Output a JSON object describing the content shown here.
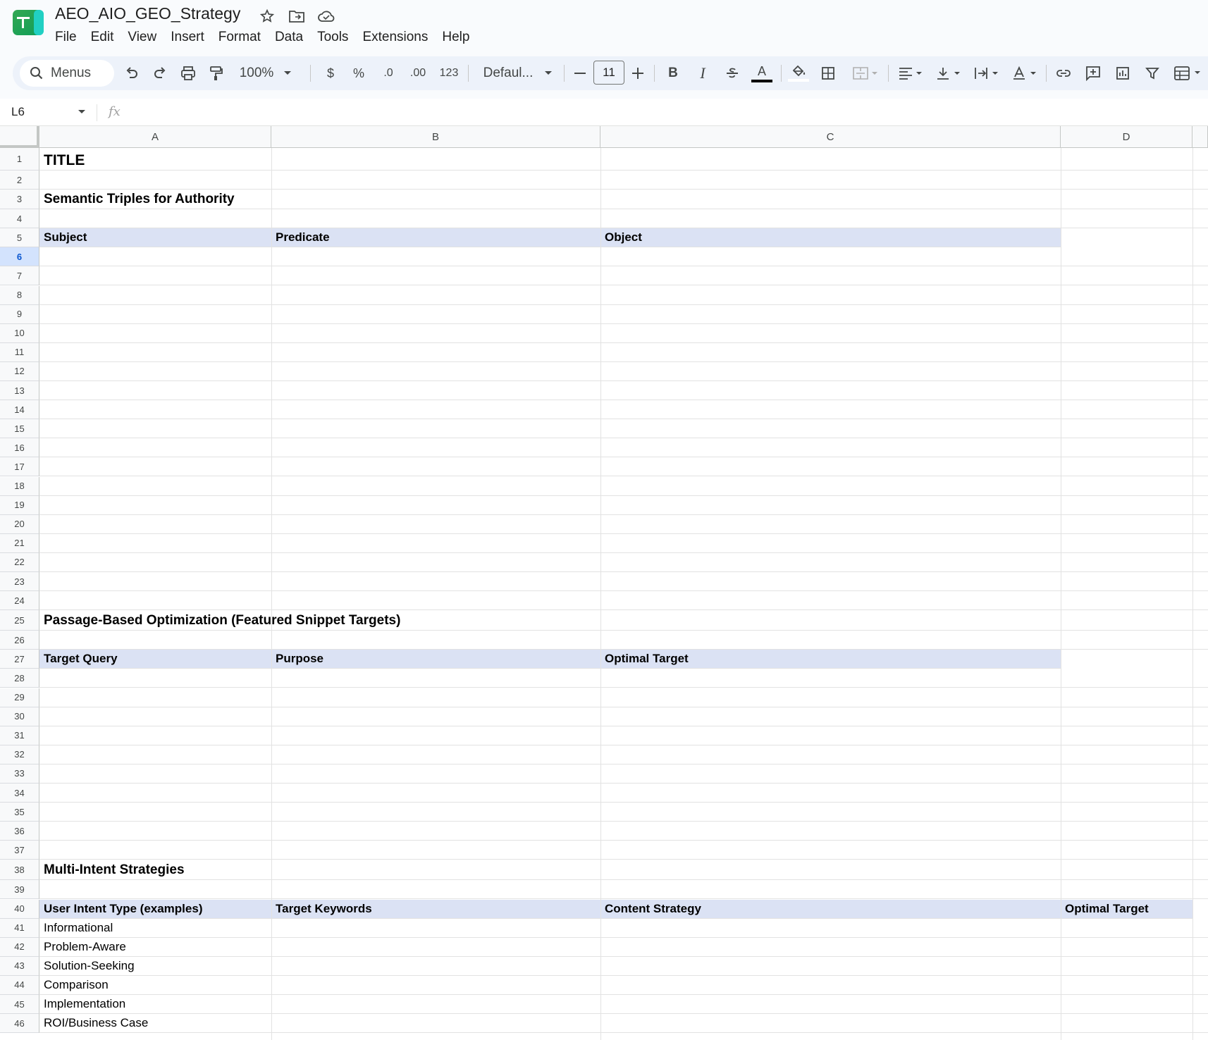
{
  "document": {
    "title": "AEO_AIO_GEO_Strategy"
  },
  "menu": [
    "File",
    "Edit",
    "View",
    "Insert",
    "Format",
    "Data",
    "Tools",
    "Extensions",
    "Help"
  ],
  "toolbar": {
    "search_label": "Menus",
    "zoom": "100%",
    "currency": "$",
    "percent": "%",
    "decrease_decimal": ".0",
    "increase_decimal": ".00",
    "number_format": "123",
    "font": "Defaul...",
    "font_size": "11",
    "bold": "B",
    "italic": "I",
    "text_color_glyph": "A"
  },
  "formula_bar": {
    "cell_ref": "L6",
    "fx": "fx",
    "value": ""
  },
  "columns": [
    "A",
    "B",
    "C",
    "D"
  ],
  "selected_row": 6,
  "rows": [
    {
      "n": "1",
      "cells": [
        {
          "col": "A",
          "text": "TITLE",
          "style": "title"
        }
      ]
    },
    {
      "n": "2",
      "cells": []
    },
    {
      "n": "3",
      "cells": [
        {
          "col": "A",
          "text": "Semantic Triples for Authority",
          "style": "section"
        }
      ]
    },
    {
      "n": "4",
      "cells": []
    },
    {
      "n": "5",
      "header": true,
      "cells": [
        {
          "col": "A",
          "text": "Subject",
          "style": "b"
        },
        {
          "col": "B",
          "text": "Predicate",
          "style": "b"
        },
        {
          "col": "C",
          "text": "Object",
          "style": "b"
        }
      ]
    },
    {
      "n": "6",
      "cells": []
    },
    {
      "n": "7",
      "cells": []
    },
    {
      "n": "8",
      "cells": []
    },
    {
      "n": "9",
      "cells": []
    },
    {
      "n": "10",
      "cells": []
    },
    {
      "n": "11",
      "cells": []
    },
    {
      "n": "12",
      "cells": []
    },
    {
      "n": "13",
      "cells": []
    },
    {
      "n": "14",
      "cells": []
    },
    {
      "n": "15",
      "cells": []
    },
    {
      "n": "16",
      "cells": []
    },
    {
      "n": "17",
      "cells": []
    },
    {
      "n": "18",
      "cells": []
    },
    {
      "n": "19",
      "cells": []
    },
    {
      "n": "20",
      "cells": []
    },
    {
      "n": "21",
      "cells": []
    },
    {
      "n": "22",
      "cells": []
    },
    {
      "n": "23",
      "cells": []
    },
    {
      "n": "24",
      "cells": []
    },
    {
      "n": "25",
      "cells": [
        {
          "col": "A",
          "text": "Passage-Based Optimization (Featured Snippet Targets)",
          "style": "section"
        }
      ]
    },
    {
      "n": "26",
      "cells": []
    },
    {
      "n": "27",
      "header": true,
      "cells": [
        {
          "col": "A",
          "text": "Target Query",
          "style": "b"
        },
        {
          "col": "B",
          "text": "Purpose",
          "style": "b"
        },
        {
          "col": "C",
          "text": "Optimal Target",
          "style": "b"
        }
      ]
    },
    {
      "n": "28",
      "cells": []
    },
    {
      "n": "29",
      "cells": []
    },
    {
      "n": "30",
      "cells": []
    },
    {
      "n": "31",
      "cells": []
    },
    {
      "n": "32",
      "cells": []
    },
    {
      "n": "33",
      "cells": []
    },
    {
      "n": "34",
      "cells": []
    },
    {
      "n": "35",
      "cells": []
    },
    {
      "n": "36",
      "cells": []
    },
    {
      "n": "37",
      "cells": []
    },
    {
      "n": "38",
      "cells": [
        {
          "col": "A",
          "text": "Multi-Intent Strategies",
          "style": "section"
        }
      ]
    },
    {
      "n": "39",
      "cells": []
    },
    {
      "n": "40",
      "header": true,
      "header_wide": true,
      "cells": [
        {
          "col": "A",
          "text": "User Intent Type (examples)",
          "style": "b"
        },
        {
          "col": "B",
          "text": "Target Keywords",
          "style": "b"
        },
        {
          "col": "C",
          "text": "Content Strategy",
          "style": "b"
        },
        {
          "col": "D",
          "text": "Optimal Target",
          "style": "b"
        }
      ]
    },
    {
      "n": "41",
      "cells": [
        {
          "col": "A",
          "text": "Informational"
        }
      ]
    },
    {
      "n": "42",
      "cells": [
        {
          "col": "A",
          "text": "Problem-Aware"
        }
      ]
    },
    {
      "n": "43",
      "cells": [
        {
          "col": "A",
          "text": "Solution-Seeking"
        }
      ]
    },
    {
      "n": "44",
      "cells": [
        {
          "col": "A",
          "text": "Comparison"
        }
      ]
    },
    {
      "n": "45",
      "cells": [
        {
          "col": "A",
          "text": "Implementation"
        }
      ]
    },
    {
      "n": "46",
      "cells": [
        {
          "col": "A",
          "text": "ROI/Business Case"
        }
      ]
    }
  ],
  "colors": {
    "header_fill": "#dbe2f4",
    "selected_row": "#d3e3fd",
    "toolbar_bg": "#edf2fa",
    "logo_green": "#0f9d58"
  }
}
